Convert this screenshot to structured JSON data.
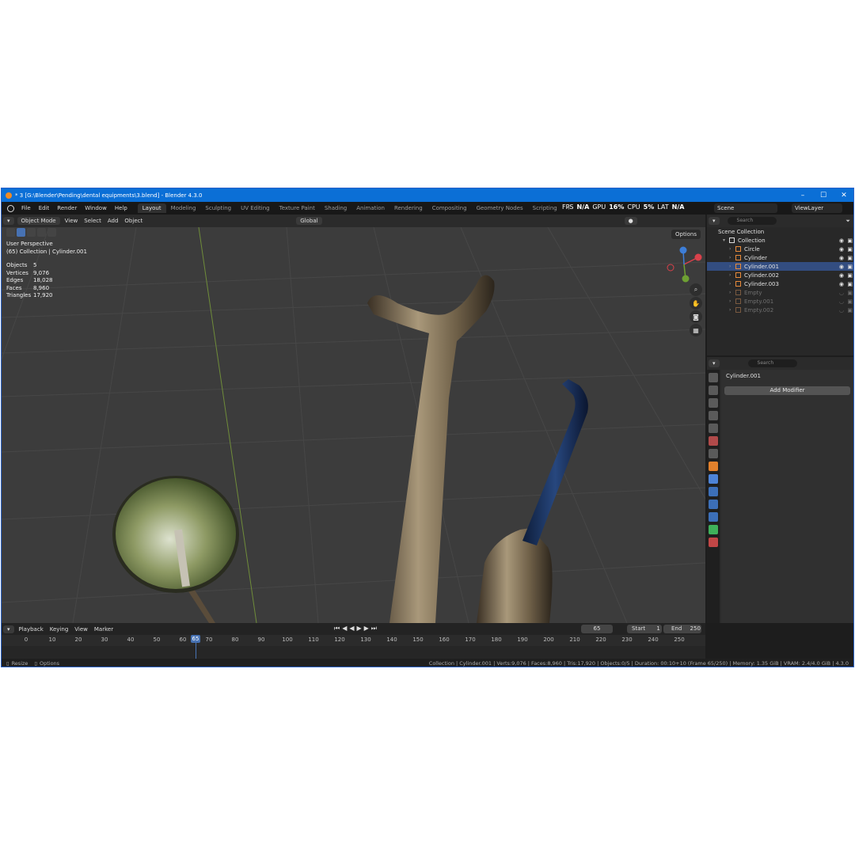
{
  "window": {
    "title": "* 3 [G:\\Blender\\Pending\\dental equipments\\3.blend] - Blender 4.3.0",
    "controls": [
      "–",
      "☐",
      "✕"
    ]
  },
  "menu": [
    "File",
    "Edit",
    "Render",
    "Window",
    "Help"
  ],
  "workspaces": [
    "Layout",
    "Modeling",
    "Sculpting",
    "UV Editing",
    "Texture Paint",
    "Shading",
    "Animation",
    "Rendering",
    "Compositing",
    "Geometry Nodes",
    "Scripting",
    "+"
  ],
  "perf": {
    "fps_label": "FPS",
    "fps": "N/A",
    "gpu_label": "GPU",
    "gpu": "16%",
    "cpu_label": "CPU",
    "cpu": "5%",
    "lat_label": "LAT",
    "lat": "N/A"
  },
  "scene": {
    "scene_name": "Scene",
    "view_layer": "ViewLayer"
  },
  "viewport": {
    "mode": "Object Mode",
    "menus": [
      "View",
      "Select",
      "Add",
      "Object"
    ],
    "transform": "Global",
    "options": "Options",
    "perspective": "User Perspective",
    "context": "(65) Collection | Cylinder.001",
    "stats": [
      {
        "label": "Objects",
        "value": "5"
      },
      {
        "label": "Vertices",
        "value": "9,076"
      },
      {
        "label": "Edges",
        "value": "18,028"
      },
      {
        "label": "Faces",
        "value": "8,960"
      },
      {
        "label": "Triangles",
        "value": "17,920"
      }
    ],
    "gizmo": {
      "x": "X",
      "y": "Y",
      "z": "Z"
    }
  },
  "outliner": {
    "search_placeholder": "Search",
    "root": "Scene Collection",
    "collection": "Collection",
    "items": [
      {
        "name": "Circle",
        "hidden": false
      },
      {
        "name": "Cylinder",
        "hidden": false
      },
      {
        "name": "Cylinder.001",
        "hidden": false
      },
      {
        "name": "Cylinder.002",
        "hidden": false
      },
      {
        "name": "Cylinder.003",
        "hidden": false
      },
      {
        "name": "Empty",
        "hidden": true
      },
      {
        "name": "Empty.001",
        "hidden": true
      },
      {
        "name": "Empty.002",
        "hidden": true
      }
    ]
  },
  "properties": {
    "search_placeholder": "Search",
    "object": "Cylinder.001",
    "add_modifier": "Add Modifier"
  },
  "timeline": {
    "menus": [
      "Playback",
      "Keying",
      "View",
      "Marker"
    ],
    "current_frame": "65",
    "start_label": "Start",
    "start": "1",
    "end_label": "End",
    "end": "250",
    "ticks": [
      "0",
      "10",
      "20",
      "30",
      "40",
      "50",
      "60",
      "70",
      "80",
      "90",
      "100",
      "110",
      "120",
      "130",
      "140",
      "150",
      "160",
      "170",
      "180",
      "190",
      "200",
      "210",
      "220",
      "230",
      "240",
      "250"
    ],
    "cursor_label": "65"
  },
  "status": {
    "left1": "Resize",
    "left2": "Options",
    "right": "Collection | Cylinder.001 | Verts:9,076 | Faces:8,960 | Tris:17,920 | Objects:0/5 | Duration: 00:10+10 (Frame 65/250) | Memory: 1.35 GiB | VRAM: 2.4/4.0 GiB | 4.3.0"
  }
}
